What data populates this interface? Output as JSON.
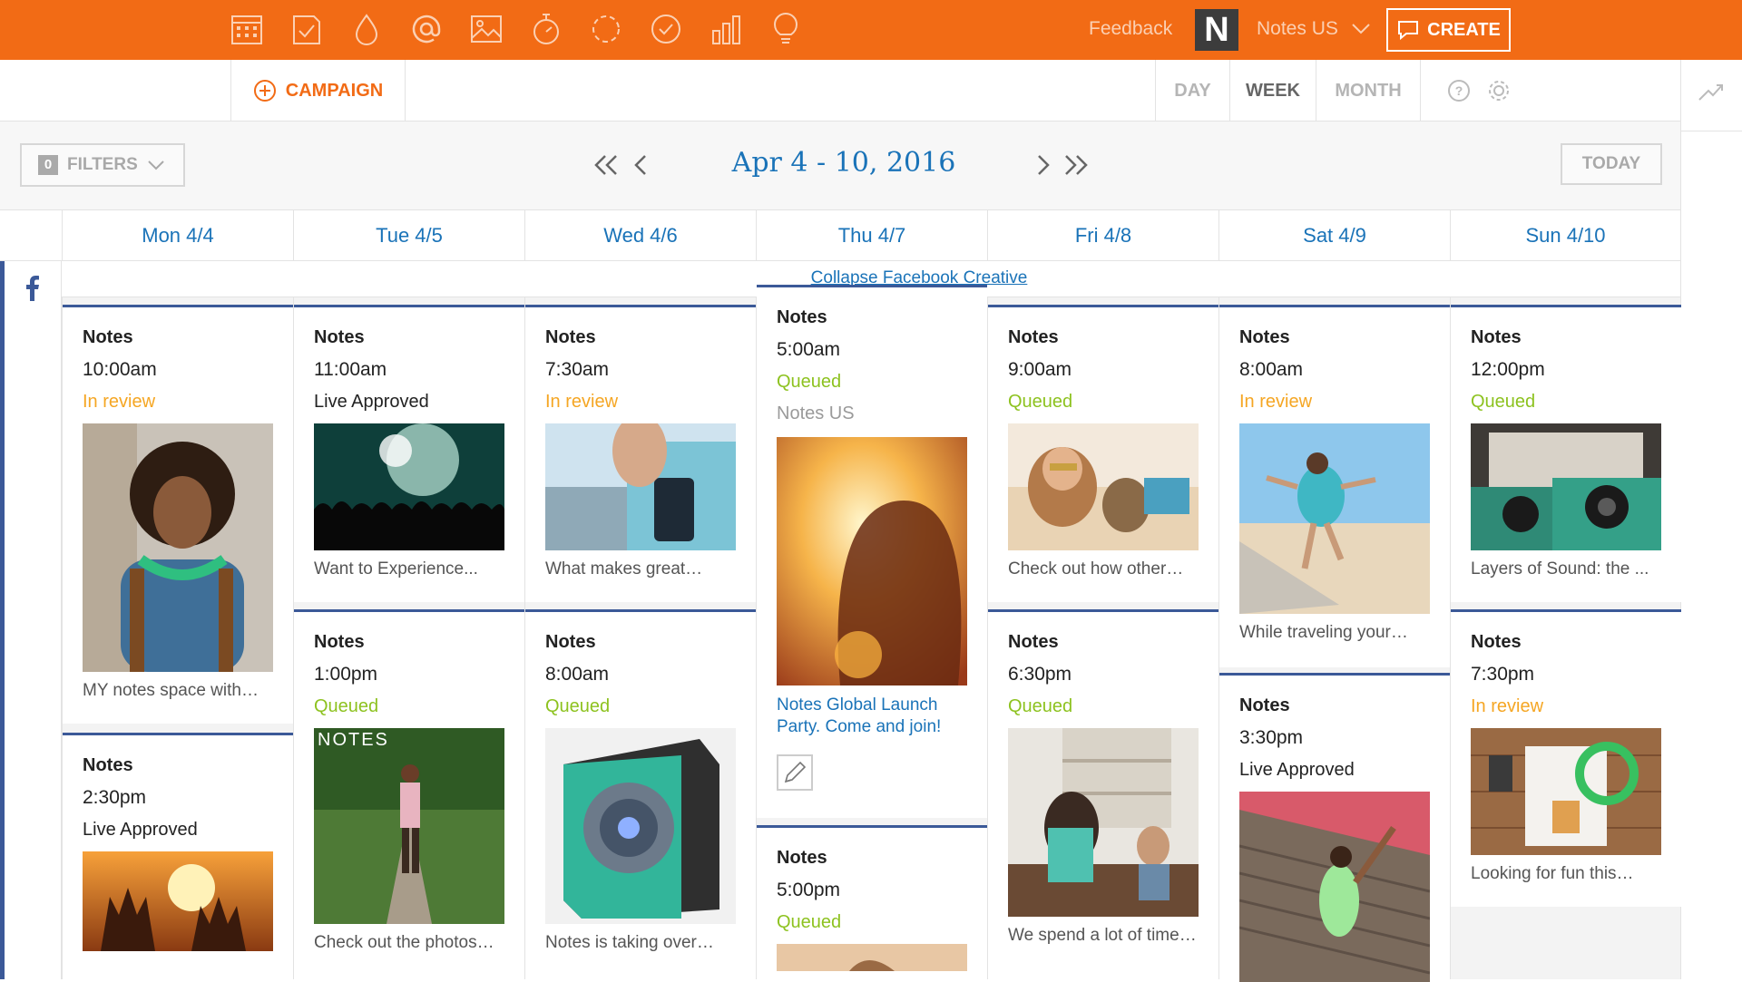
{
  "topbar": {
    "tools": [
      "calendar-icon",
      "checklist-icon",
      "drop-icon",
      "mention-icon",
      "image-icon",
      "stopwatch-icon",
      "refresh-icon",
      "check-circle-icon",
      "bar-chart-icon",
      "lightbulb-icon"
    ],
    "feedback": "Feedback",
    "brand_letter": "N",
    "account": "Notes US",
    "create_label": "CREATE"
  },
  "subbar": {
    "campaign_label": "CAMPAIGN",
    "views": [
      "DAY",
      "WEEK",
      "MONTH"
    ],
    "active_view": "WEEK"
  },
  "toolbar": {
    "filters_count": "0",
    "filters_label": "FILTERS",
    "date_range": "Apr 4 - 10, 2016",
    "today_label": "TODAY"
  },
  "days": [
    "Mon 4/4",
    "Tue 4/5",
    "Wed 4/6",
    "Thu 4/7",
    "Fri 4/8",
    "Sat 4/9",
    "Sun 4/10"
  ],
  "collapse_link": "Collapse Facebook Creative",
  "columns": [
    [
      {
        "account": "Notes",
        "time": "10:00am",
        "status": "In review",
        "caption": "MY notes space with…"
      },
      {
        "account": "Notes",
        "time": "2:30pm",
        "status": "Live Approved",
        "caption": ""
      }
    ],
    [
      {
        "account": "Notes",
        "time": "11:00am",
        "status": "Live Approved",
        "caption": "Want to Experience..."
      },
      {
        "account": "Notes",
        "time": "1:00pm",
        "status": "Queued",
        "caption": "Check out the photos…",
        "img_text": "NOTES"
      }
    ],
    [
      {
        "account": "Notes",
        "time": "7:30am",
        "status": "In review",
        "caption": "What makes great…"
      },
      {
        "account": "Notes",
        "time": "8:00am",
        "status": "Queued",
        "caption": "Notes is taking over…"
      }
    ],
    [
      {
        "account": "Notes",
        "time": "5:00am",
        "status": "Queued",
        "sub": "Notes US",
        "caption": "Notes Global Launch Party. Come and join!"
      },
      {
        "account": "Notes",
        "time": "5:00pm",
        "status": "Queued",
        "caption": ""
      }
    ],
    [
      {
        "account": "Notes",
        "time": "9:00am",
        "status": "Queued",
        "caption": "Check out how other…"
      },
      {
        "account": "Notes",
        "time": "6:30pm",
        "status": "Queued",
        "caption": "We spend a lot of time…"
      }
    ],
    [
      {
        "account": "Notes",
        "time": "8:00am",
        "status": "In review",
        "caption": "While traveling your…"
      },
      {
        "account": "Notes",
        "time": "3:30pm",
        "status": "Live Approved",
        "caption": ""
      }
    ],
    [
      {
        "account": "Notes",
        "time": "12:00pm",
        "status": "Queued",
        "caption": "Layers of Sound: the ..."
      },
      {
        "account": "Notes",
        "time": "7:30pm",
        "status": "In review",
        "caption": "Looking for fun this…"
      }
    ]
  ],
  "colors": {
    "brand": "#f26b15",
    "link": "#1a73b8",
    "facebook": "#3b5998",
    "review": "#f5a623",
    "queued": "#8dc21f"
  }
}
